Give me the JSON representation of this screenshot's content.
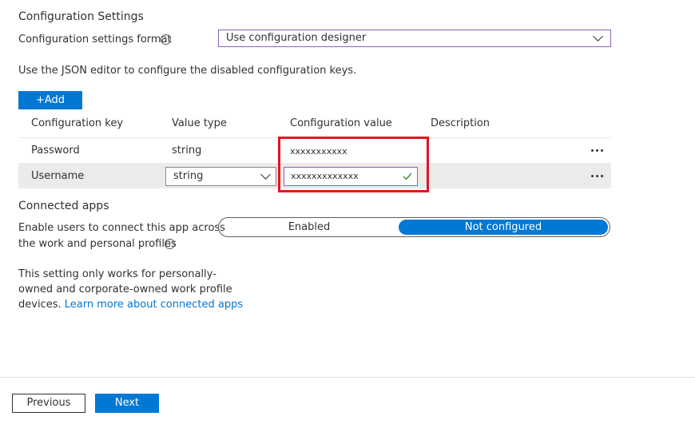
{
  "config": {
    "title": "Configuration Settings",
    "format_label": "Configuration settings format",
    "format_value": "Use configuration designer",
    "note": "Use the JSON editor to configure the disabled configuration keys.",
    "add_label": "+Add"
  },
  "table": {
    "headers": [
      "Configuration key",
      "Value type",
      "Configuration value",
      "Description"
    ],
    "rows": [
      {
        "key": "Password",
        "type": "string",
        "value": "xxxxxxxxxxx"
      },
      {
        "key": "Username",
        "type": "string",
        "value": "xxxxxxxxxxxxx"
      }
    ]
  },
  "connected": {
    "title": "Connected apps",
    "label_line1": "Enable users to connect this app across",
    "label_line2": "the work and personal profiles",
    "options": [
      "Enabled",
      "Not configured"
    ],
    "selected": "Not configured",
    "note_line1": "This setting only works for personally-",
    "note_line2": "owned and corporate-owned work profile",
    "note_line3": "devices.",
    "link": "Learn more about connected apps"
  },
  "footer": {
    "previous": "Previous",
    "next": "Next"
  },
  "colors": {
    "accent": "#0078d4",
    "highlight": "#e81123",
    "focus": "#8764b8",
    "valid": "#107c10"
  },
  "icons": {
    "info": "info-icon",
    "more": "more-icon",
    "chevron": "chevron-down-icon",
    "check": "checkmark-icon"
  }
}
